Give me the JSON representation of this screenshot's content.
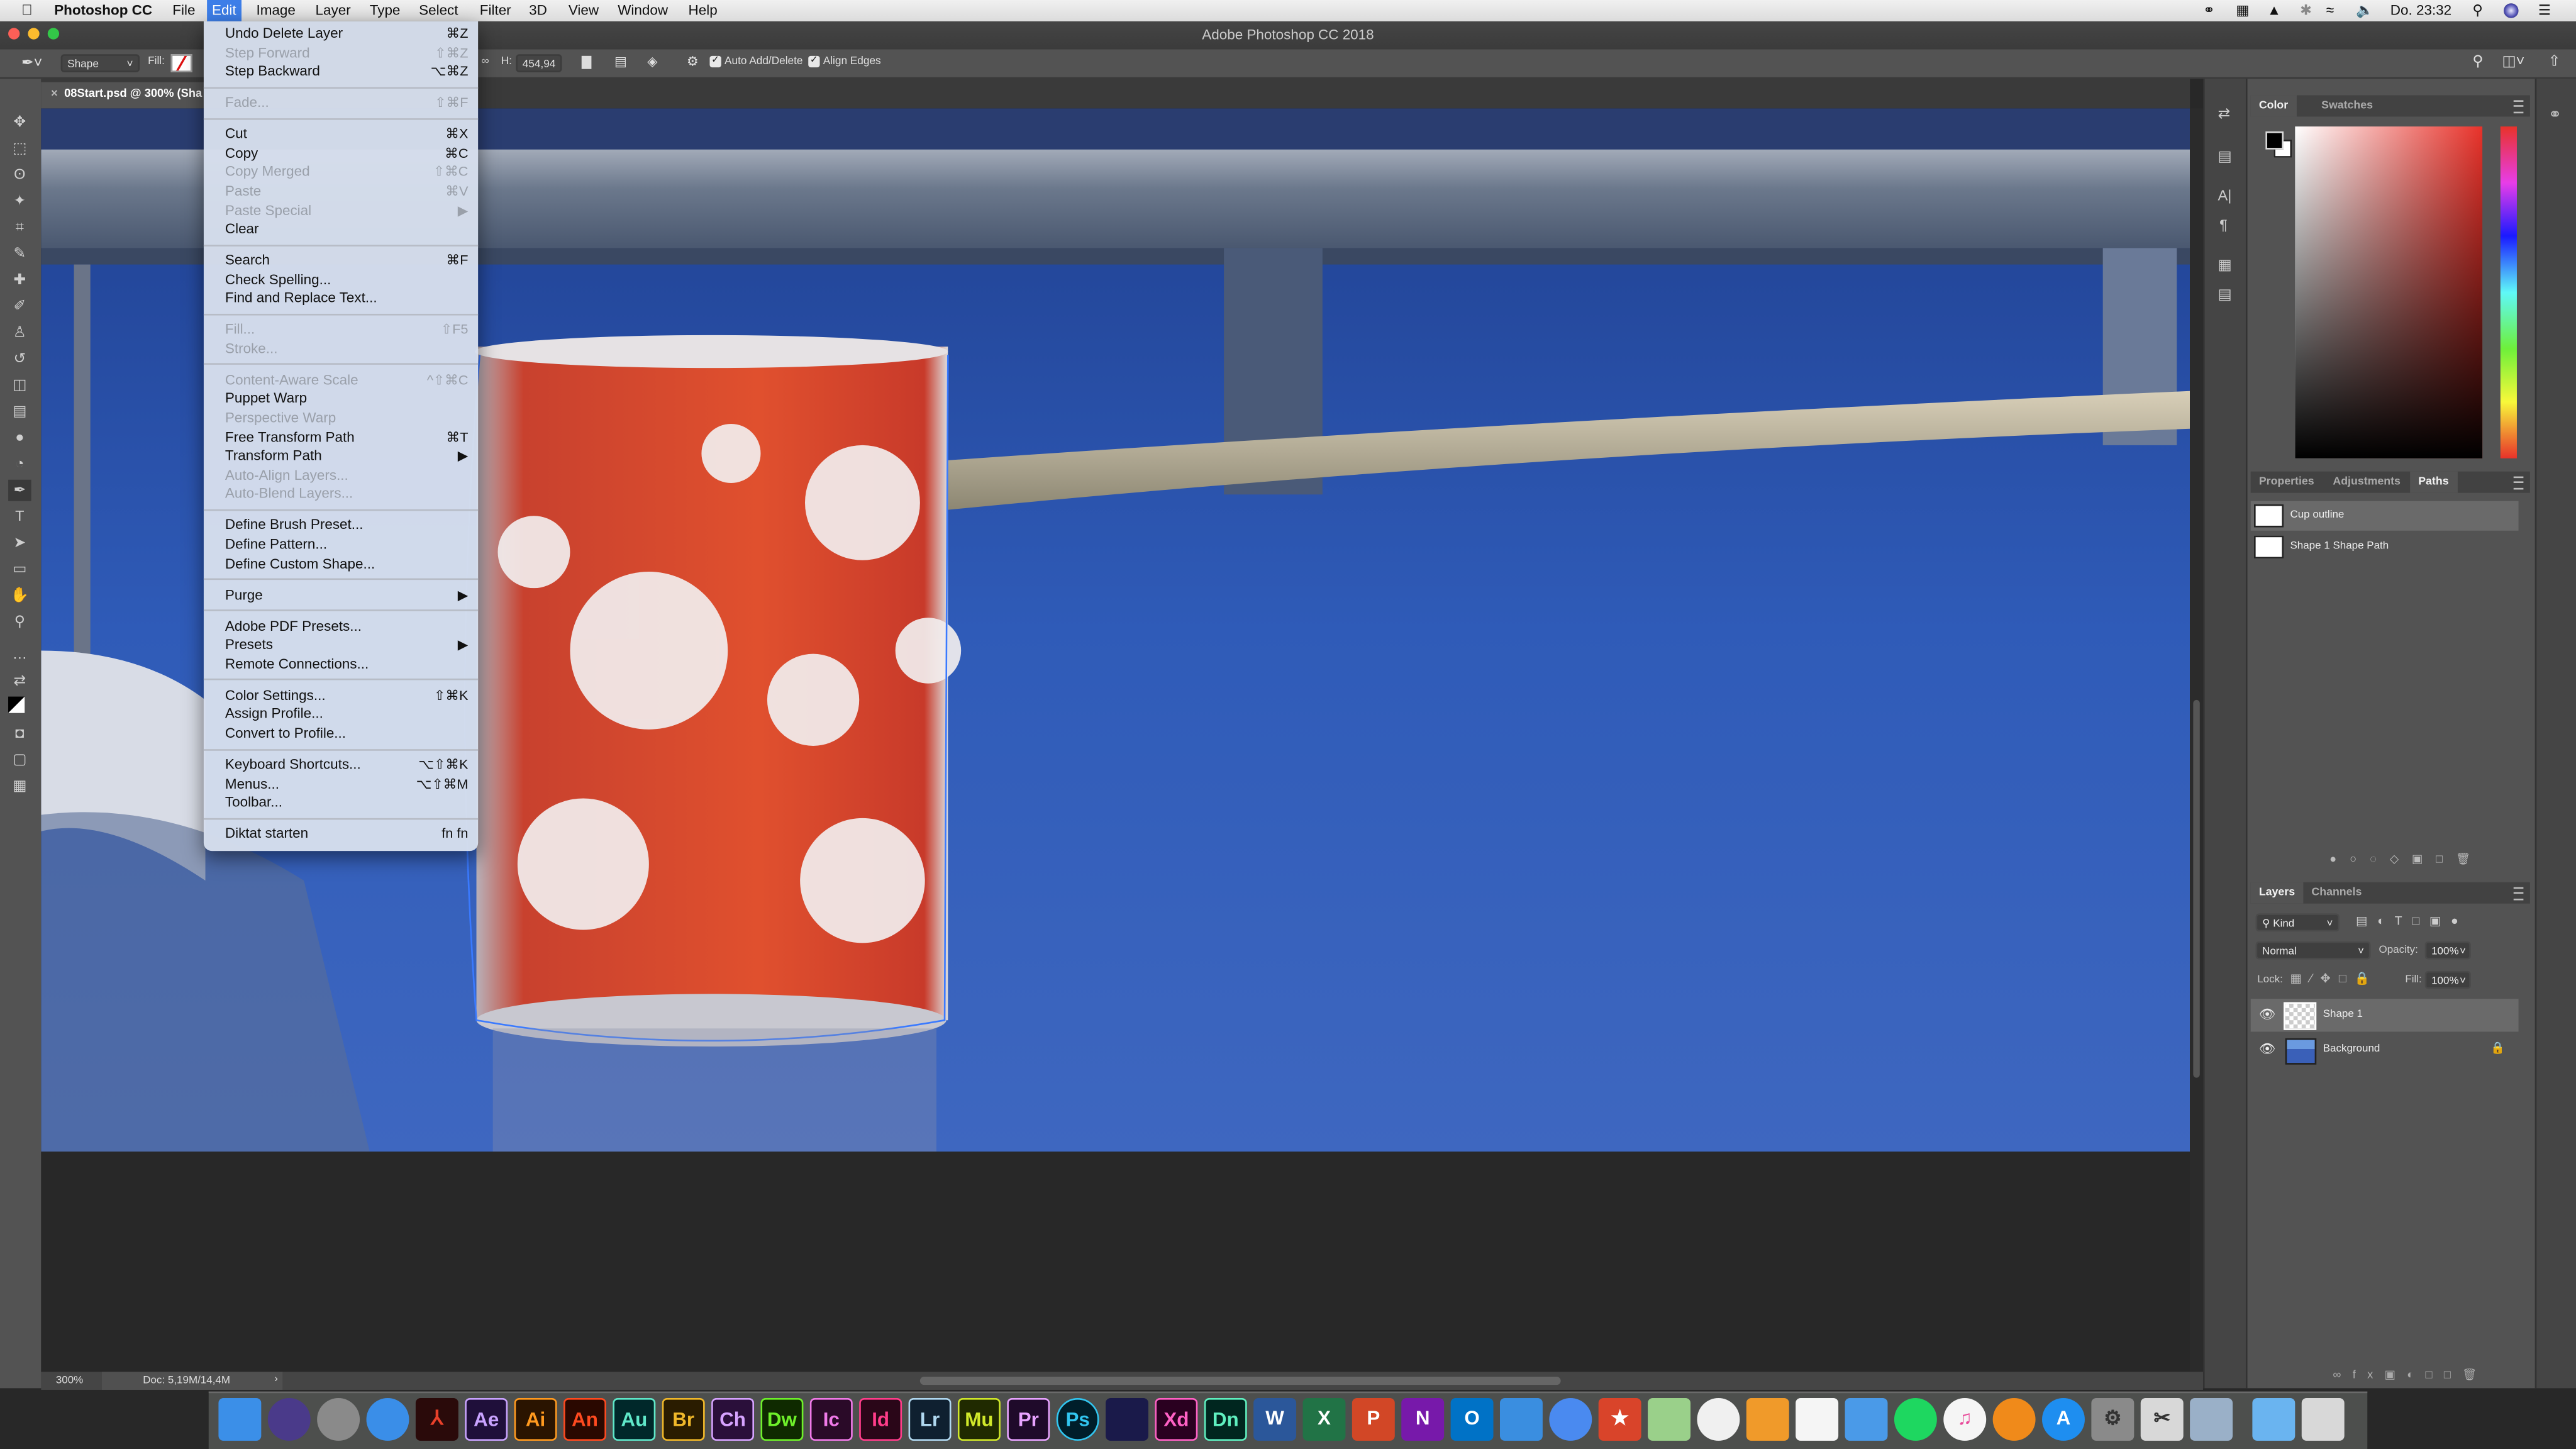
{
  "menubar": {
    "app_name": "Photoshop CC",
    "items": [
      "File",
      "Edit",
      "Image",
      "Layer",
      "Type",
      "Select",
      "Filter",
      "3D",
      "View",
      "Window",
      "Help"
    ],
    "active": "Edit",
    "clock": "Do. 23:32",
    "status_icons": [
      "creative-cloud-icon",
      "display-layout-icon",
      "airplay-icon",
      "bluetooth-icon",
      "wifi-icon",
      "volume-icon"
    ],
    "accent": "#3d7ee8"
  },
  "window": {
    "title": "Adobe Photoshop CC 2018"
  },
  "options_bar": {
    "tool_mode": "Shape",
    "fill_label": "Fill:",
    "h_label": "H:",
    "h_value": "454,94",
    "auto_add_delete": {
      "label": "Auto Add/Delete",
      "checked": true
    },
    "align_edges": {
      "label": "Align Edges",
      "checked": true
    }
  },
  "document_tab": {
    "title": "08Start.psd @ 300% (Sha"
  },
  "tools": [
    "move",
    "marquee",
    "lasso",
    "magic-wand",
    "crop",
    "eyedropper",
    "healing-brush",
    "brush",
    "clone-stamp",
    "history-brush",
    "eraser",
    "gradient",
    "blur",
    "dodge",
    "pen",
    "type",
    "path-selection",
    "rectangle",
    "hand",
    "zoom",
    "more",
    "swap-colors",
    "foreground-background",
    "quick-mask",
    "screen-mode",
    "artboard"
  ],
  "status_bar": {
    "zoom": "300%",
    "doc_info": "Doc: 5,19M/14,4M",
    "arrow": "›"
  },
  "edit_menu": [
    {
      "label": "Undo Delete Layer",
      "shortcut": "⌘Z"
    },
    {
      "label": "Step Forward",
      "shortcut": "⇧⌘Z",
      "disabled": true
    },
    {
      "label": "Step Backward",
      "shortcut": "⌥⌘Z"
    },
    {
      "sep": true
    },
    {
      "label": "Fade...",
      "shortcut": "⇧⌘F",
      "disabled": true
    },
    {
      "sep": true
    },
    {
      "label": "Cut",
      "shortcut": "⌘X"
    },
    {
      "label": "Copy",
      "shortcut": "⌘C"
    },
    {
      "label": "Copy Merged",
      "shortcut": "⇧⌘C",
      "disabled": true
    },
    {
      "label": "Paste",
      "shortcut": "⌘V",
      "disabled": true
    },
    {
      "label": "Paste Special",
      "shortcut": "▶",
      "disabled": true
    },
    {
      "label": "Clear",
      "shortcut": ""
    },
    {
      "sep": true
    },
    {
      "label": "Search",
      "shortcut": "⌘F"
    },
    {
      "label": "Check Spelling...",
      "shortcut": ""
    },
    {
      "label": "Find and Replace Text...",
      "shortcut": ""
    },
    {
      "sep": true
    },
    {
      "label": "Fill...",
      "shortcut": "⇧F5",
      "disabled": true
    },
    {
      "label": "Stroke...",
      "shortcut": "",
      "disabled": true
    },
    {
      "sep": true
    },
    {
      "label": "Content-Aware Scale",
      "shortcut": "^⇧⌘C",
      "disabled": true
    },
    {
      "label": "Puppet Warp",
      "shortcut": ""
    },
    {
      "label": "Perspective Warp",
      "shortcut": "",
      "disabled": true
    },
    {
      "label": "Free Transform Path",
      "shortcut": "⌘T"
    },
    {
      "label": "Transform Path",
      "shortcut": "▶"
    },
    {
      "label": "Auto-Align Layers...",
      "shortcut": "",
      "disabled": true
    },
    {
      "label": "Auto-Blend Layers...",
      "shortcut": "",
      "disabled": true
    },
    {
      "sep": true
    },
    {
      "label": "Define Brush Preset...",
      "shortcut": ""
    },
    {
      "label": "Define Pattern...",
      "shortcut": ""
    },
    {
      "label": "Define Custom Shape...",
      "shortcut": ""
    },
    {
      "sep": true
    },
    {
      "label": "Purge",
      "shortcut": "▶"
    },
    {
      "sep": true
    },
    {
      "label": "Adobe PDF Presets...",
      "shortcut": ""
    },
    {
      "label": "Presets",
      "shortcut": "▶"
    },
    {
      "label": "Remote Connections...",
      "shortcut": ""
    },
    {
      "sep": true
    },
    {
      "label": "Color Settings...",
      "shortcut": "⇧⌘K"
    },
    {
      "label": "Assign Profile...",
      "shortcut": ""
    },
    {
      "label": "Convert to Profile...",
      "shortcut": ""
    },
    {
      "sep": true
    },
    {
      "label": "Keyboard Shortcuts...",
      "shortcut": "⌥⇧⌘K"
    },
    {
      "label": "Menus...",
      "shortcut": "⌥⇧⌘M"
    },
    {
      "label": "Toolbar...",
      "shortcut": ""
    },
    {
      "sep": true
    },
    {
      "label": "Diktat starten",
      "shortcut": "fn fn"
    }
  ],
  "color_panel": {
    "tabs": [
      "Color",
      "Swatches"
    ],
    "active_tab": "Color",
    "foreground": "#000000",
    "background": "#ffffff",
    "hue": "#e8322a"
  },
  "paths_panel": {
    "tabs": [
      "Properties",
      "Adjustments",
      "Paths"
    ],
    "active_tab": "Paths",
    "items": [
      {
        "name": "Cup outline",
        "selected": true
      },
      {
        "name": "Shape 1 Shape Path",
        "selected": false
      }
    ]
  },
  "layers_panel": {
    "tabs": [
      "Layers",
      "Channels"
    ],
    "active_tab": "Layers",
    "filter": "Kind",
    "blend_mode": "Normal",
    "opacity_label": "Opacity:",
    "opacity": "100%",
    "lock_label": "Lock:",
    "fill_label": "Fill:",
    "fill": "100%",
    "layers": [
      {
        "name": "Shape 1",
        "visible": true,
        "selected": true
      },
      {
        "name": "Background",
        "visible": true,
        "locked": true
      }
    ]
  },
  "dock": [
    {
      "icon": "finder-icon",
      "bg": "#3b8fe8",
      "text": ""
    },
    {
      "icon": "siri-icon",
      "bg": "#4a3a8a",
      "text": ""
    },
    {
      "icon": "launchpad-icon",
      "bg": "#8a8a8a",
      "text": ""
    },
    {
      "icon": "safari-icon",
      "bg": "#3a8ee8",
      "text": ""
    },
    {
      "icon": "acrobat-icon",
      "bg": "#2a0a0a",
      "fg": "#e8402a",
      "text": "⅄"
    },
    {
      "icon": "after-effects-icon",
      "bg": "#1f0f3a",
      "fg": "#c9a3ff",
      "text": "Ae"
    },
    {
      "icon": "illustrator-icon",
      "bg": "#2a1400",
      "fg": "#ff9a1f",
      "text": "Ai"
    },
    {
      "icon": "animate-icon",
      "bg": "#2a0800",
      "fg": "#ff4a1f",
      "text": "An"
    },
    {
      "icon": "audition-icon",
      "bg": "#00282a",
      "fg": "#5fe8c9",
      "text": "Au"
    },
    {
      "icon": "bridge-icon",
      "bg": "#2a1c00",
      "fg": "#f0b82a",
      "text": "Br"
    },
    {
      "icon": "character-animator-icon",
      "bg": "#2a0f3a",
      "fg": "#d6a3ff",
      "text": "Ch"
    },
    {
      "icon": "dreamweaver-icon",
      "bg": "#0f2a00",
      "fg": "#6ef02a",
      "text": "Dw"
    },
    {
      "icon": "incopy-icon",
      "bg": "#2a0a28",
      "fg": "#f07ae8",
      "text": "Ic"
    },
    {
      "icon": "indesign-icon",
      "bg": "#2a0618",
      "fg": "#ff3d8a",
      "text": "Id"
    },
    {
      "icon": "lightroom-icon",
      "bg": "#0f2030",
      "fg": "#b0d8f0",
      "text": "Lr"
    },
    {
      "icon": "muse-icon",
      "bg": "#202a00",
      "fg": "#d0e82a",
      "text": "Mu"
    },
    {
      "icon": "premiere-icon",
      "bg": "#1f0a2a",
      "fg": "#e8a3ff",
      "text": "Pr"
    },
    {
      "icon": "photoshop-icon",
      "bg": "#001e2a",
      "fg": "#31c5f0",
      "text": "Ps"
    },
    {
      "icon": "media-encoder-icon",
      "bg": "#1a1a4a",
      "fg": "#b0b0ff",
      "text": ""
    },
    {
      "icon": "xd-icon",
      "bg": "#2a0020",
      "fg": "#ff61c5",
      "text": "Xd"
    },
    {
      "icon": "dimension-icon",
      "bg": "#00261f",
      "fg": "#5ff0c0",
      "text": "Dn"
    },
    {
      "icon": "word-icon",
      "bg": "#2b579a",
      "fg": "#fff",
      "text": "W"
    },
    {
      "icon": "excel-icon",
      "bg": "#217346",
      "fg": "#fff",
      "text": "X"
    },
    {
      "icon": "powerpoint-icon",
      "bg": "#d24726",
      "fg": "#fff",
      "text": "P"
    },
    {
      "icon": "onenote-icon",
      "bg": "#7719aa",
      "fg": "#fff",
      "text": "N"
    },
    {
      "icon": "outlook-icon",
      "bg": "#0072c6",
      "fg": "#fff",
      "text": "O"
    },
    {
      "icon": "icloud-drive-icon",
      "bg": "#3a8ee0",
      "text": ""
    },
    {
      "icon": "chrome-icon",
      "bg": "#4a8af0",
      "text": ""
    },
    {
      "icon": "wunderlist-icon",
      "bg": "#d9442a",
      "fg": "#fff",
      "text": "★"
    },
    {
      "icon": "maps-icon",
      "bg": "#9ad08a",
      "text": ""
    },
    {
      "icon": "photos-icon",
      "bg": "#f0f0f0",
      "text": ""
    },
    {
      "icon": "pages-icon",
      "bg": "#f09a2a",
      "text": ""
    },
    {
      "icon": "numbers-icon",
      "bg": "#f5f5f5",
      "text": ""
    },
    {
      "icon": "keynote-icon",
      "bg": "#4a9ae8",
      "text": ""
    },
    {
      "icon": "spotify-icon",
      "bg": "#1ed760",
      "text": ""
    },
    {
      "icon": "itunes-icon",
      "bg": "#f5f5f5",
      "fg": "#e84a9a",
      "text": "♫"
    },
    {
      "icon": "ibooks-icon",
      "bg": "#f08a1a",
      "text": ""
    },
    {
      "icon": "app-store-icon",
      "bg": "#1e8ef0",
      "fg": "#fff",
      "text": "A"
    },
    {
      "icon": "system-preferences-icon",
      "bg": "#8a8a8a",
      "fg": "#333",
      "text": "⚙"
    },
    {
      "icon": "screenshot-icon",
      "bg": "#d8d8d8",
      "fg": "#333",
      "text": "✂"
    },
    {
      "icon": "preview-icon",
      "bg": "#9ab0c8",
      "text": ""
    },
    {
      "icon": "downloads-folder-icon",
      "bg": "#6ab4f0",
      "text": ""
    },
    {
      "icon": "trash-icon",
      "bg": "#d8d8d8",
      "text": ""
    }
  ]
}
